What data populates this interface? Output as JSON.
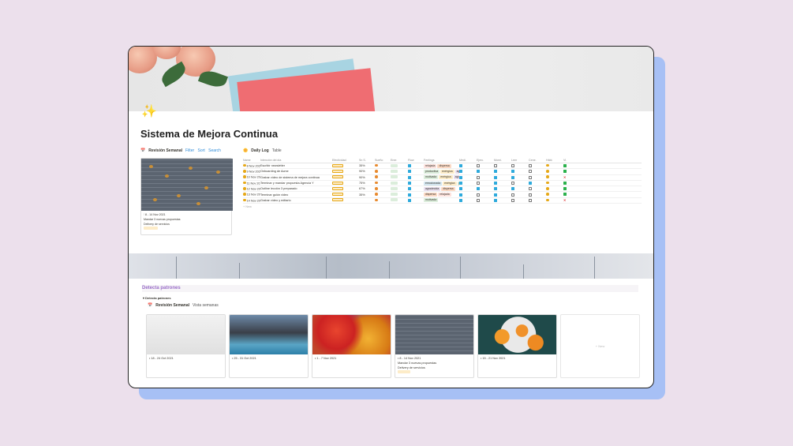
{
  "page": {
    "title": "Sistema de Mejora Continua",
    "icon": "sparkles-icon"
  },
  "revision": {
    "title": "Revisión Semanal",
    "filter": "Filter",
    "sort": "Sort",
    "search": "Search",
    "card": {
      "date": "8 - 14 Nov 2021",
      "line1": "Mandar 3 nuevas propuestas",
      "line2": "Delivery de servicios"
    }
  },
  "daily_log": {
    "title": "Daily Log",
    "view": "Table",
    "columns": [
      "Name",
      "Intención del día",
      "Efectividad",
      "Sn S.",
      "Sueño",
      "Ener.",
      "Flow",
      "Feelings",
      "Medi.",
      "Ejerc.",
      "Morni.",
      "Leer",
      "Cene.",
      "Hábi.",
      "Vi."
    ],
    "rows": [
      {
        "date": "8 Nov 2021",
        "intent": "Escribir newsletter",
        "pct": "35%",
        "feel": [
          [
            "relajada",
            "#fde2dd"
          ],
          [
            "dispersa",
            "#fbd9c4"
          ]
        ],
        "cb": [
          1,
          0,
          0,
          0,
          0
        ],
        "hab": "dot",
        "res": "sq"
      },
      {
        "date": "9 Nov 2021",
        "intent": "Onboarding de Acme",
        "pct": "90%",
        "feel": [
          [
            "productiva",
            "#dbeddb"
          ],
          [
            "enérgica",
            "#fdecc8"
          ],
          [
            "agradecida",
            "#e8deee"
          ]
        ],
        "cb": [
          1,
          1,
          1,
          1,
          0
        ],
        "hab": "dot",
        "res": "sq"
      },
      {
        "date": "10 Nov 2021",
        "intent": "Grabar vídeo de sistema de mejora continua",
        "pct": "90%",
        "feel": [
          [
            "motivada",
            "#dbeddb"
          ],
          [
            "enérgica",
            "#fdecc8"
          ],
          [
            "agradecida",
            "#e8deee"
          ]
        ],
        "cb": [
          1,
          0,
          1,
          1,
          0
        ],
        "hab": "dot",
        "res": "x"
      },
      {
        "date": "11 Nov 2021",
        "intent": "Terminar y mandar propuesta Agencia Y",
        "pct": "75%",
        "feel": [
          [
            "emocionada",
            "#d3e5ef"
          ],
          [
            "enérgica",
            "#fdecc8"
          ],
          [
            "productiva",
            "#dbeddb"
          ]
        ],
        "cb": [
          1,
          0,
          1,
          0,
          1
        ],
        "hab": "dot",
        "res": "sq"
      },
      {
        "date": "12 Nov 2021",
        "intent": "Outline lección 3 preparado",
        "pct": "67%",
        "feel": [
          [
            "agradecida",
            "#e8deee"
          ],
          [
            "dispersa",
            "#fbd9c4"
          ]
        ],
        "cb": [
          1,
          1,
          1,
          1,
          0
        ],
        "hab": "dot",
        "res": "sq"
      },
      {
        "date": "13 Nov 2021",
        "intent": "Terminar guión video",
        "pct": "35%",
        "feel": [
          [
            "dispersa",
            "#fbd9c4"
          ],
          [
            "relajada",
            "#fde2dd"
          ]
        ],
        "cb": [
          1,
          0,
          1,
          0,
          0
        ],
        "hab": "dot",
        "res": "sq"
      },
      {
        "date": "14 Nov 2021",
        "intent": "Grabar vídeo y editarlo",
        "pct": "",
        "feel": [
          [
            "motivada",
            "#dbeddb"
          ]
        ],
        "cb": [
          1,
          0,
          1,
          0,
          0
        ],
        "hab": "dot",
        "res": "x"
      }
    ],
    "new_label": "New"
  },
  "patrones": {
    "heading": "Detecta patrones",
    "toggle": "Detecta patrones",
    "gallery_title": "Revisión Semanal",
    "gallery_view": "Vista semanas",
    "cards": [
      {
        "date": "18 - 24 Oct 2021",
        "icon": "brush-icon"
      },
      {
        "date": "25 - 31 Oct 2021",
        "icon": "globe-icon"
      },
      {
        "date": "1 - 7 Nov 2021",
        "icon": "clapper-icon"
      },
      {
        "date": "8 - 14 Nov 2021",
        "icon": "candle-icon",
        "line1": "Mandar 3 nuevas propuestas",
        "line2": "Delivery de servicios"
      },
      {
        "date": "15 - 21 Nov 2021",
        "icon": "ruler-icon"
      }
    ],
    "new_label": "New"
  }
}
